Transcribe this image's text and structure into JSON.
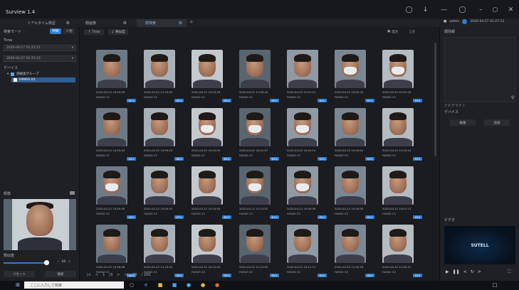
{
  "window": {
    "title": "Surview 1.4"
  },
  "titlebar_icons": [
    "bell-icon",
    "download-icon",
    "menu-icon",
    "user-circle-icon",
    "minimize-icon",
    "restore-icon",
    "close-icon"
  ],
  "tabs": [
    {
      "label": "リアルタイム検証"
    },
    {
      "label": "顔画像"
    },
    {
      "label": "顔検索"
    }
  ],
  "user": {
    "name": "admin",
    "datetime": "2020-04-27 01:27:13"
  },
  "left": {
    "mode_label": "検索モード",
    "mode_btn_active": "時間",
    "mode_btn": "人物",
    "time_label": "Time",
    "start_time": "2020-04-17 01:25:11",
    "end_time": "2020-04-27 01:25:13",
    "device_label": "デバイス",
    "tree_root": "顔検索グループ",
    "tree_child": "FAMAS V2",
    "face_label": "顔像",
    "threshold_label": "類似度",
    "threshold_value": "80",
    "reset_btn": "リセット",
    "search_btn": "検索"
  },
  "main": {
    "sort_time": "Time",
    "sort_similarity": "類似度",
    "export_label": "出力",
    "select_all": "全選",
    "pager": {
      "page": "1",
      "total": "/3",
      "per_page": "50",
      "count": "/ 100"
    }
  },
  "results": [
    {
      "time": "2020-04-22 10:53:59",
      "device": "FAMAS V2",
      "score": "81%",
      "mask": false
    },
    {
      "time": "2020-04-22 11:10:03",
      "device": "FAMAS V2",
      "score": "82%",
      "mask": false
    },
    {
      "time": "2020-04-22 10:53:59",
      "device": "FAMAS V2",
      "score": "80%",
      "mask": false
    },
    {
      "time": "2020-04-22 11:05:44",
      "device": "FAMAS V2",
      "score": "80%",
      "mask": false
    },
    {
      "time": "2020-04-22 11:01:15",
      "device": "FAMAS V2",
      "score": "84%",
      "mask": false
    },
    {
      "time": "2020-04-22 10:05:25",
      "device": "FAMAS V2",
      "score": "81%",
      "mask": true
    },
    {
      "time": "2020-04-22 01:01:05",
      "device": "FAMAS V2",
      "score": "84%",
      "mask": true
    },
    {
      "time": "2020-04-22 10:53:45",
      "device": "FAMAS V2",
      "score": "84%",
      "mask": false
    },
    {
      "time": "2020-04-22 10:59:10",
      "device": "FAMAS V2",
      "score": "88%",
      "mask": false
    },
    {
      "time": "2020-04-22 10:00:05",
      "device": "FAMAS V2",
      "score": "80%",
      "mask": true
    },
    {
      "time": "2020-04-22 10:01:07",
      "device": "FAMAS V2",
      "score": "85%",
      "mask": true
    },
    {
      "time": "2020-04-22 10:50:10",
      "device": "FAMAS V2",
      "score": "82%",
      "mask": true
    },
    {
      "time": "2020-04-22 10:04:02",
      "device": "FAMAS V2",
      "score": "82%",
      "mask": false
    },
    {
      "time": "2020-04-22 11:15:10",
      "device": "FAMAS V2",
      "score": "85%",
      "mask": false
    },
    {
      "time": "2020-04-22 10:55:40",
      "device": "FAMAS V2",
      "score": "80%",
      "mask": true
    },
    {
      "time": "2020-04-22 10:00:42",
      "device": "FAMAS V2",
      "score": "87%",
      "mask": false
    },
    {
      "time": "2020-04-22 10:10:04",
      "device": "FAMAS V2",
      "score": "80%",
      "mask": false
    },
    {
      "time": "2020-04-22 11:12:02",
      "device": "FAMAS V2",
      "score": "81%",
      "mask": true
    },
    {
      "time": "2020-04-22 10:00:06",
      "device": "FAMAS V2",
      "score": "85%",
      "mask": true
    },
    {
      "time": "2020-04-22 10:55:05",
      "device": "FAMAS V2",
      "score": "80%",
      "mask": false
    },
    {
      "time": "2020-04-22 10:07:13",
      "device": "FAMAS V2",
      "score": "85%",
      "mask": false
    },
    {
      "time": "2020-04-22 10:56:08",
      "device": "FAMAS V2",
      "score": "80%",
      "mask": false
    },
    {
      "time": "2020-04-22 11:10:54",
      "device": "FAMAS V2",
      "score": "80%",
      "mask": false
    },
    {
      "time": "2020-04-22 10:10:04",
      "device": "FAMAS V2",
      "score": "85%",
      "mask": false
    },
    {
      "time": "2020-04-22 11:10:00",
      "device": "FAMAS V2",
      "score": "80%",
      "mask": false
    },
    {
      "time": "2020-04-22 10:11:11",
      "device": "FAMAS V2",
      "score": "85%",
      "mask": false
    },
    {
      "time": "2020-04-22 11:05:18",
      "device": "FAMAS V2",
      "score": "80%",
      "mask": false
    },
    {
      "time": "2020-04-22 11:40:12",
      "device": "FAMAS V2",
      "score": "84%",
      "mask": false
    }
  ],
  "right": {
    "title": "顔情報",
    "section2": "ナビゲライト",
    "device_label": "デバイス",
    "btn1": "編集",
    "btn2": "追加",
    "video_label": "ビデオ",
    "brand": "SUTELL"
  },
  "taskbar": {
    "search_placeholder": "ここに入力して検索"
  },
  "colors": {
    "accent": "#2f7dd1",
    "bg": "#1c1d21"
  }
}
